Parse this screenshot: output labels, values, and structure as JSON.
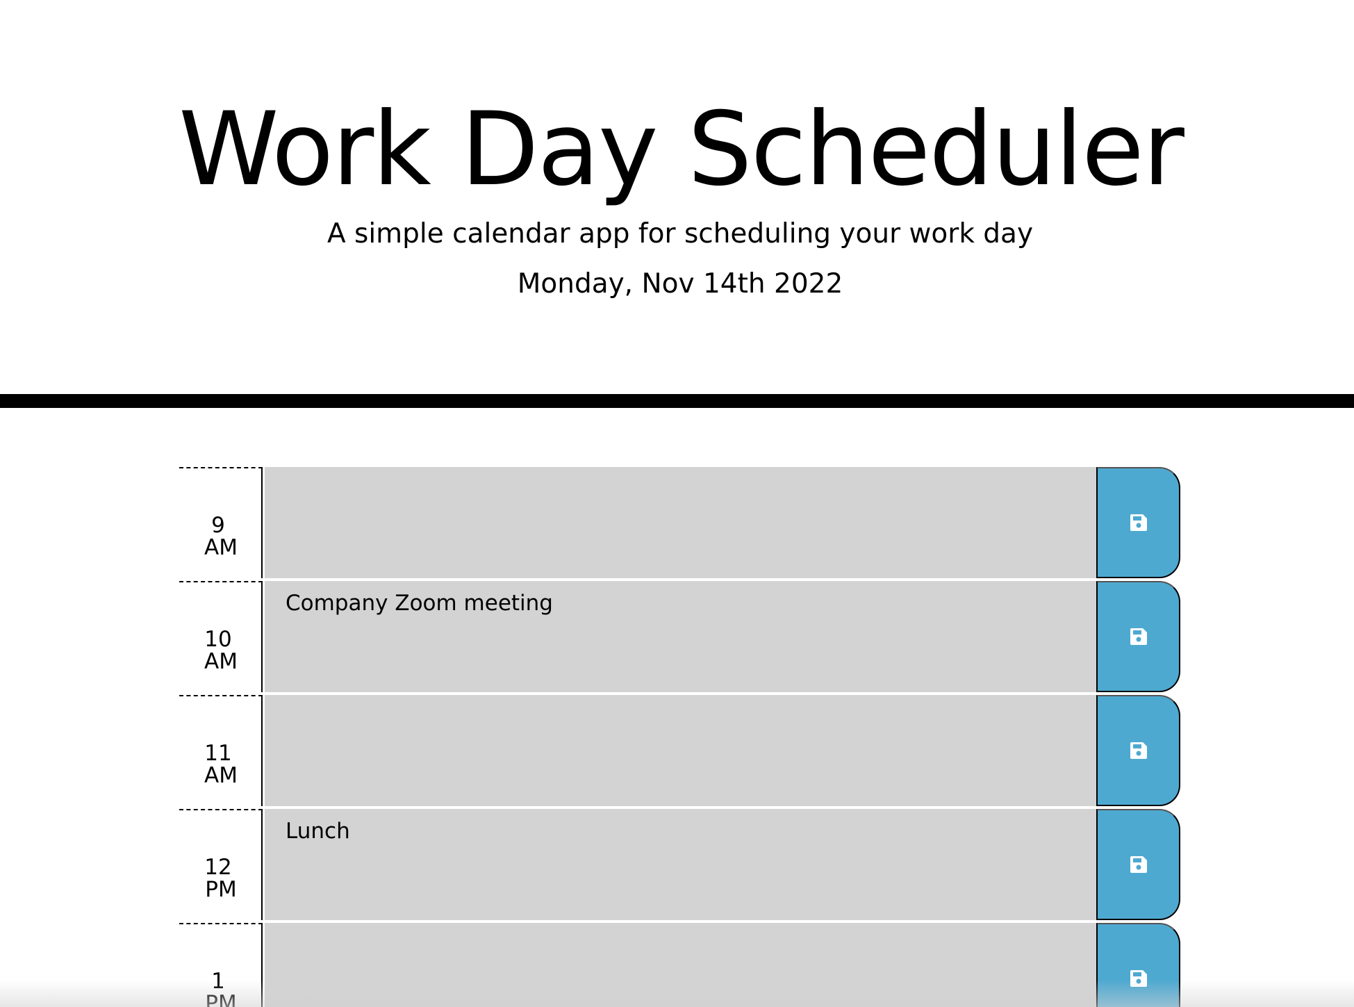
{
  "header": {
    "title": "Work Day Scheduler",
    "subtitle": "A simple calendar app for scheduling your work day",
    "current_day": "Monday, Nov 14th 2022"
  },
  "colors": {
    "header_rule": "#000000",
    "past_block": "#d3d3d3",
    "save_button": "#4ea9d1",
    "save_icon": "#ffffff"
  },
  "time_blocks": [
    {
      "hour": "9",
      "period": "AM",
      "description": "",
      "save_icon": "floppy-disk-icon"
    },
    {
      "hour": "10",
      "period": "AM",
      "description": "Company Zoom meeting",
      "save_icon": "floppy-disk-icon"
    },
    {
      "hour": "11",
      "period": "AM",
      "description": "",
      "save_icon": "floppy-disk-icon"
    },
    {
      "hour": "12",
      "period": "PM",
      "description": "Lunch",
      "save_icon": "floppy-disk-icon"
    },
    {
      "hour": "1",
      "period": "PM",
      "description": "",
      "save_icon": "floppy-disk-icon"
    }
  ]
}
